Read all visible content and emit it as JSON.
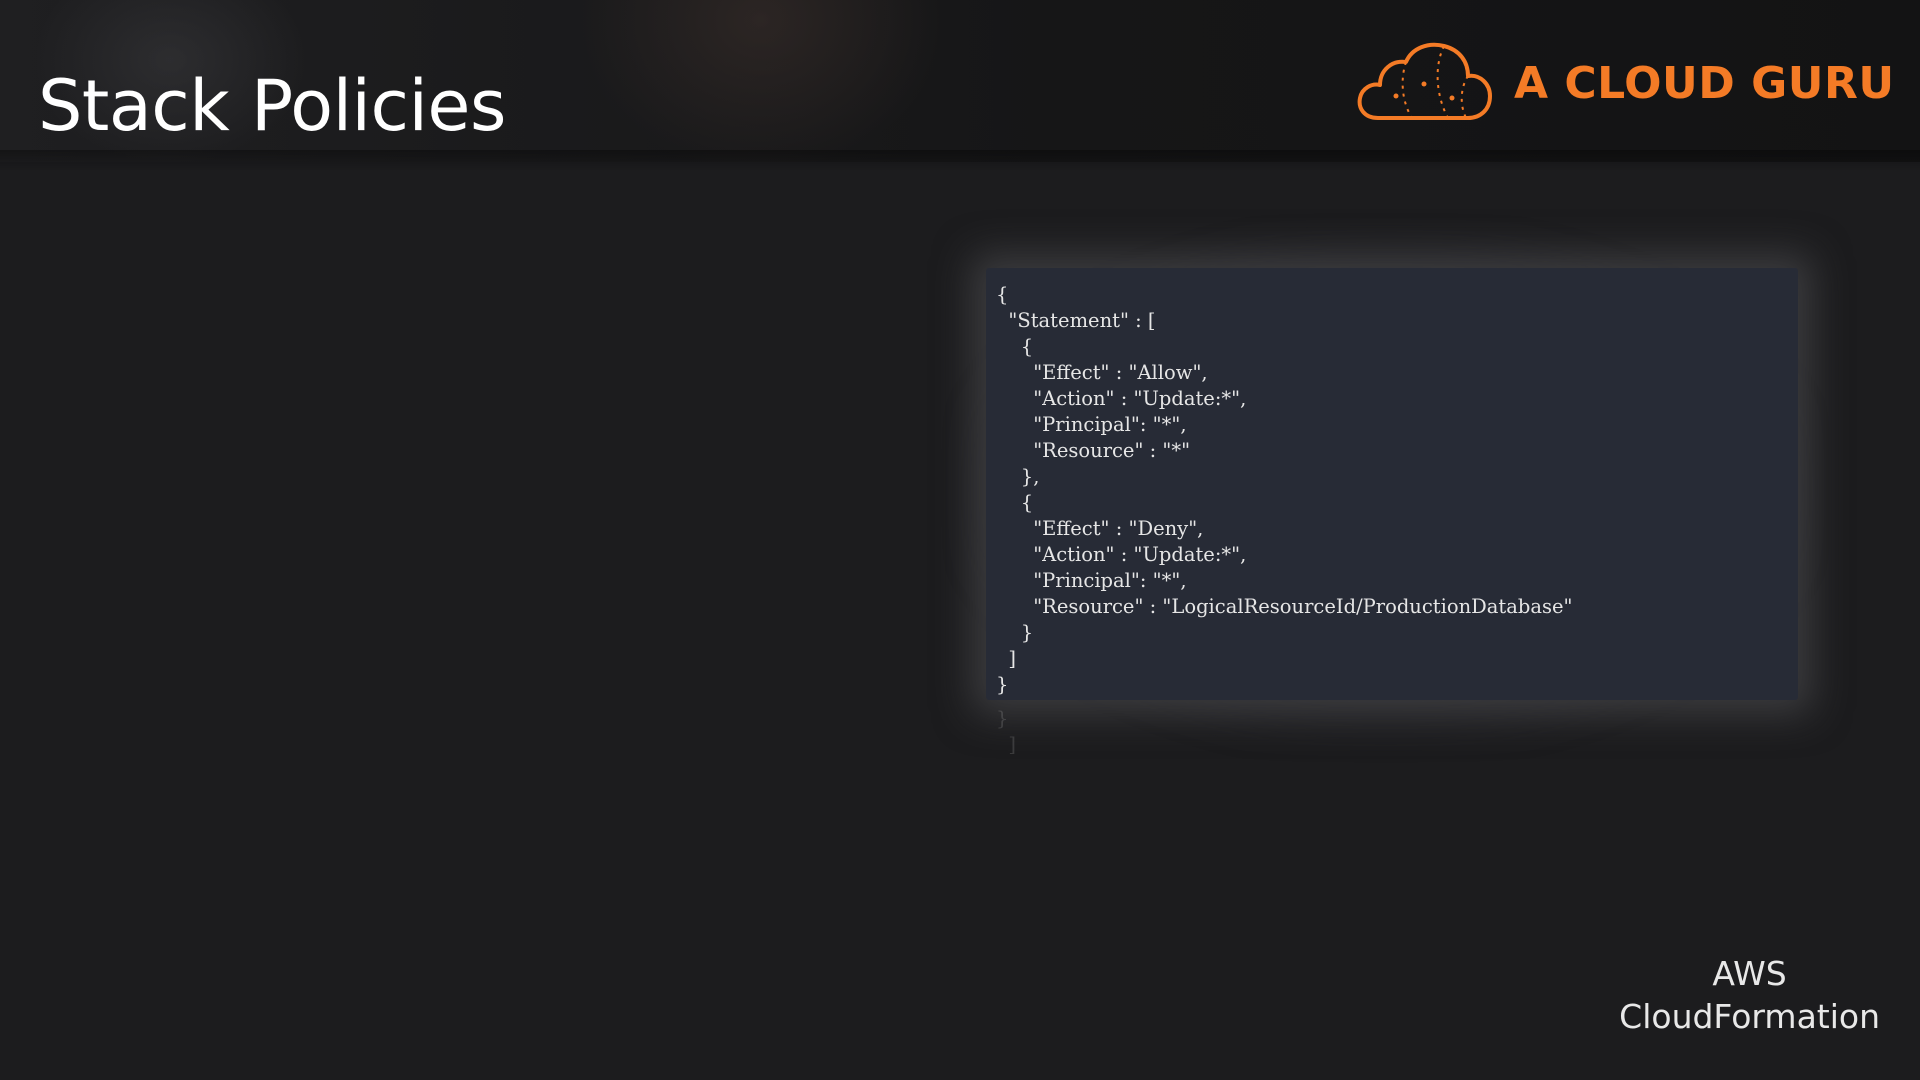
{
  "slide": {
    "title": "Stack Policies"
  },
  "brand": {
    "name": "A CLOUD GURU",
    "icon": "cloud-logo-icon",
    "color": "#f47b26"
  },
  "code_panel": {
    "lines": [
      "{",
      "  \"Statement\" : [",
      "    {",
      "      \"Effect\" : \"Allow\",",
      "      \"Action\" : \"Update:*\",",
      "      \"Principal\": \"*\",",
      "      \"Resource\" : \"*\"",
      "    },",
      "    {",
      "      \"Effect\" : \"Deny\",",
      "      \"Action\" : \"Update:*\",",
      "      \"Principal\": \"*\",",
      "      \"Resource\" : \"LogicalResourceId/ProductionDatabase\"",
      "    }",
      "  ]",
      "}"
    ],
    "reflection_lines": [
      "}",
      "  ]"
    ]
  },
  "footer": {
    "course_line1": "AWS",
    "course_line2": "CloudFormation"
  }
}
